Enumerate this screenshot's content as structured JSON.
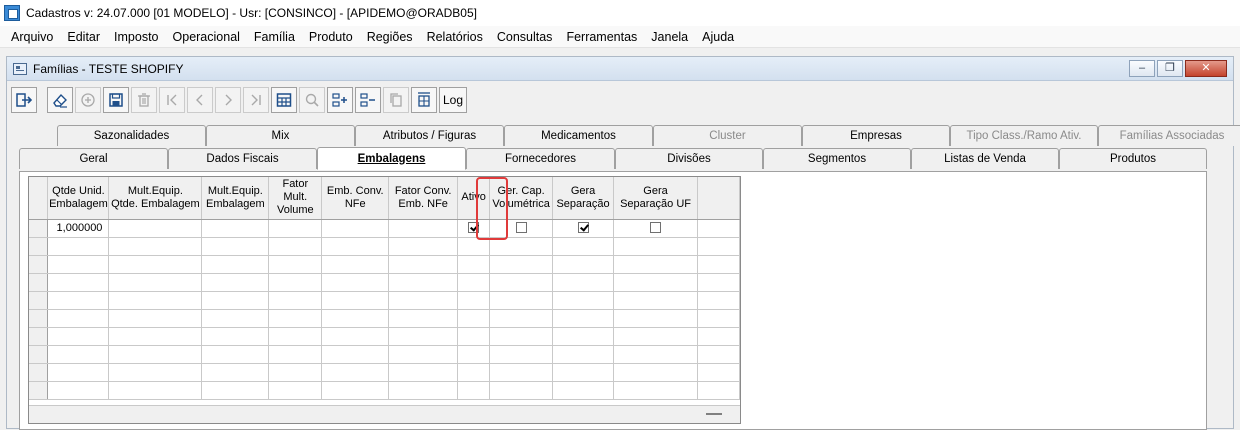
{
  "app": {
    "title": "Cadastros  v: 24.07.000   [01 MODELO] - Usr: [CONSINCO] - [APIDEMO@ORADB05]"
  },
  "menu": [
    "Arquivo",
    "Editar",
    "Imposto",
    "Operacional",
    "Família",
    "Produto",
    "Regiões",
    "Relatórios",
    "Consultas",
    "Ferramentas",
    "Janela",
    "Ajuda"
  ],
  "window": {
    "title": "Famílias - TESTE SHOPIFY",
    "buttons": {
      "minimize": "‒",
      "restore": "❐",
      "close": "✕"
    }
  },
  "toolbar": {
    "log_label": "Log",
    "icons": [
      "exit-icon",
      "eraser-icon",
      "add-icon",
      "save-icon",
      "delete-icon",
      "first-icon",
      "previous-icon",
      "next-icon",
      "last-icon",
      "grid-view-icon",
      "search-icon",
      "insert-row-icon",
      "remove-row-icon",
      "copy-icon",
      "columns-icon"
    ]
  },
  "tabs_top": [
    {
      "label": "Sazonalidades",
      "enabled": true
    },
    {
      "label": "Mix",
      "enabled": true
    },
    {
      "label": "Atributos / Figuras",
      "enabled": true
    },
    {
      "label": "Medicamentos",
      "enabled": true
    },
    {
      "label": "Cluster",
      "enabled": false
    },
    {
      "label": "Empresas",
      "enabled": true
    },
    {
      "label": "Tipo Class./Ramo Ativ.",
      "enabled": false
    },
    {
      "label": "Famílias Associadas",
      "enabled": false
    }
  ],
  "tabs_bottom": [
    {
      "label": "Geral",
      "active": false
    },
    {
      "label": "Dados Fiscais",
      "active": false
    },
    {
      "label": "Embalagens",
      "active": true
    },
    {
      "label": "Fornecedores",
      "active": false
    },
    {
      "label": "Divisões",
      "active": false
    },
    {
      "label": "Segmentos",
      "active": false
    },
    {
      "label": "Listas de Venda",
      "active": false
    },
    {
      "label": "Produtos",
      "active": false
    }
  ],
  "grid": {
    "columns": [
      "Qtde Unid.\nEmbalagem",
      "Mult.Equip.\nQtde. Embalagem",
      "Mult.Equip.\nEmbalagem",
      "Fator Mult.\nVolume",
      "Emb. Conv.\nNFe",
      "Fator Conv.\nEmb. NFe",
      "Ativo",
      "Ger. Cap.\nVolumétrica",
      "Gera\nSeparação",
      "Gera\nSeparação UF",
      ""
    ],
    "rows": [
      {
        "qtde_unid": "1,000000",
        "mult_qtde": "",
        "mult_emb": "",
        "fator_mult": "",
        "emb_conv": "",
        "fator_conv": "",
        "ativo": true,
        "ger_cap": false,
        "gera_sep": true,
        "gera_sep_uf": false
      }
    ],
    "empty_rows": 9
  }
}
